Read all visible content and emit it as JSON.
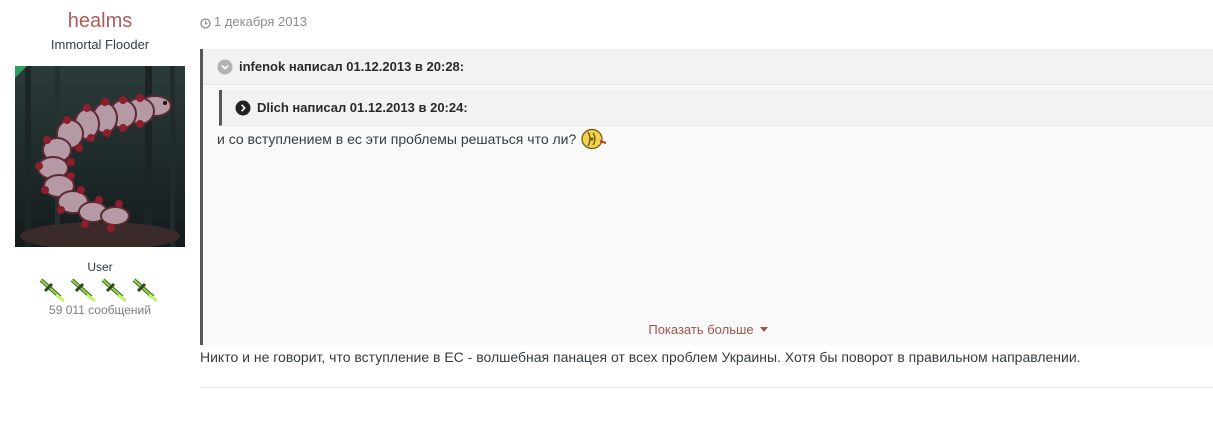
{
  "author": {
    "name": "healms",
    "title": "Immortal Flooder",
    "group": "User",
    "post_count": "59 011 сообщений",
    "rank_icons": [
      "sword-icon",
      "sword-icon",
      "sword-icon",
      "sword-icon"
    ]
  },
  "post": {
    "date": "1 декабря 2013",
    "outer_quote": {
      "citation": "infenok написал 01.12.2013 в 20:28:"
    },
    "inner_quote": {
      "citation": "Dlich написал 01.12.2013 в 20:24:"
    },
    "quote_text": "и со вступлением в ес эти проблемы решаться что ли?",
    "show_more": "Показать больше",
    "text": "Никто и не говорит, что вступление в ЕС - волшебная панацея от всех проблем Украины. Хотя бы поворот в правильном направлении."
  },
  "colors": {
    "author_name": "#b05a5a",
    "quote_border": "#575757",
    "show_more": "#a05252",
    "online": "#2e9e5b"
  }
}
